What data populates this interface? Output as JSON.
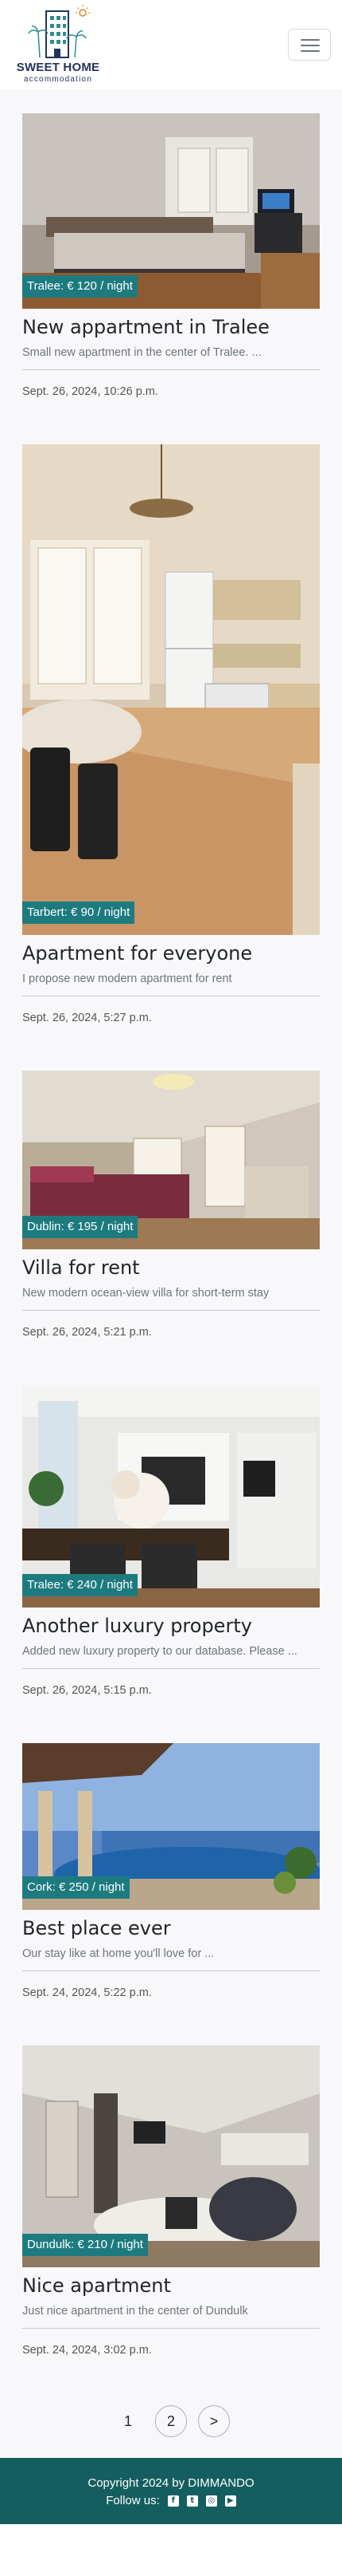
{
  "brand": {
    "title": "SWEET HOME",
    "subtitle": "accommodation",
    "logo_icon": "building-palm-sun-logo",
    "color": "#21365c"
  },
  "navbar": {
    "menu_icon": "hamburger-icon"
  },
  "listings": [
    {
      "price": "Tralee: € 120 / night",
      "title": "New appartment in Tralee",
      "description": "Small new apartment in the center of Tralee. ...",
      "date": "Sept. 26, 2024, 10:26 p.m.",
      "image": "bedroom-photo"
    },
    {
      "price": "Tarbert: € 90 / night",
      "title": "Apartment for everyone",
      "description": "I propose new modern apartment for rent",
      "date": "Sept. 26, 2024, 5:27 p.m.",
      "image": "kitchen-photo"
    },
    {
      "price": "Dublin: € 195 / night",
      "title": "Villa for rent",
      "description": "New modern ocean-view villa for short-term stay",
      "date": "Sept. 26, 2024, 5:21 p.m.",
      "image": "attic-bedroom-photo"
    },
    {
      "price": "Tralee: € 240 / night",
      "title": "Another luxury property",
      "description": "Added new luxury property to our database. Please ...",
      "date": "Sept. 26, 2024, 5:15 p.m.",
      "image": "living-room-photo"
    },
    {
      "price": "Cork: € 250 / night",
      "title": "Best place ever",
      "description": "Our stay like at home you'll love for ...",
      "date": "Sept. 24, 2024, 5:22 p.m.",
      "image": "infinity-pool-photo"
    },
    {
      "price": "Dundulk: € 210 / night",
      "title": "Nice apartment",
      "description": "Just nice apartment in the center of Dundulk",
      "date": "Sept. 24, 2024, 3:02 p.m.",
      "image": "loft-apartment-photo"
    }
  ],
  "pagination": {
    "page1": "1",
    "page2": "2",
    "next": ">"
  },
  "footer": {
    "copyright": "Copyright 2024 by DIMMANDO",
    "follow_label": "Follow us:",
    "social_icons": [
      "facebook-icon",
      "twitter-icon",
      "instagram-icon",
      "youtube-icon"
    ],
    "background": "#155e5f"
  },
  "accent_color": "#1d7b80"
}
